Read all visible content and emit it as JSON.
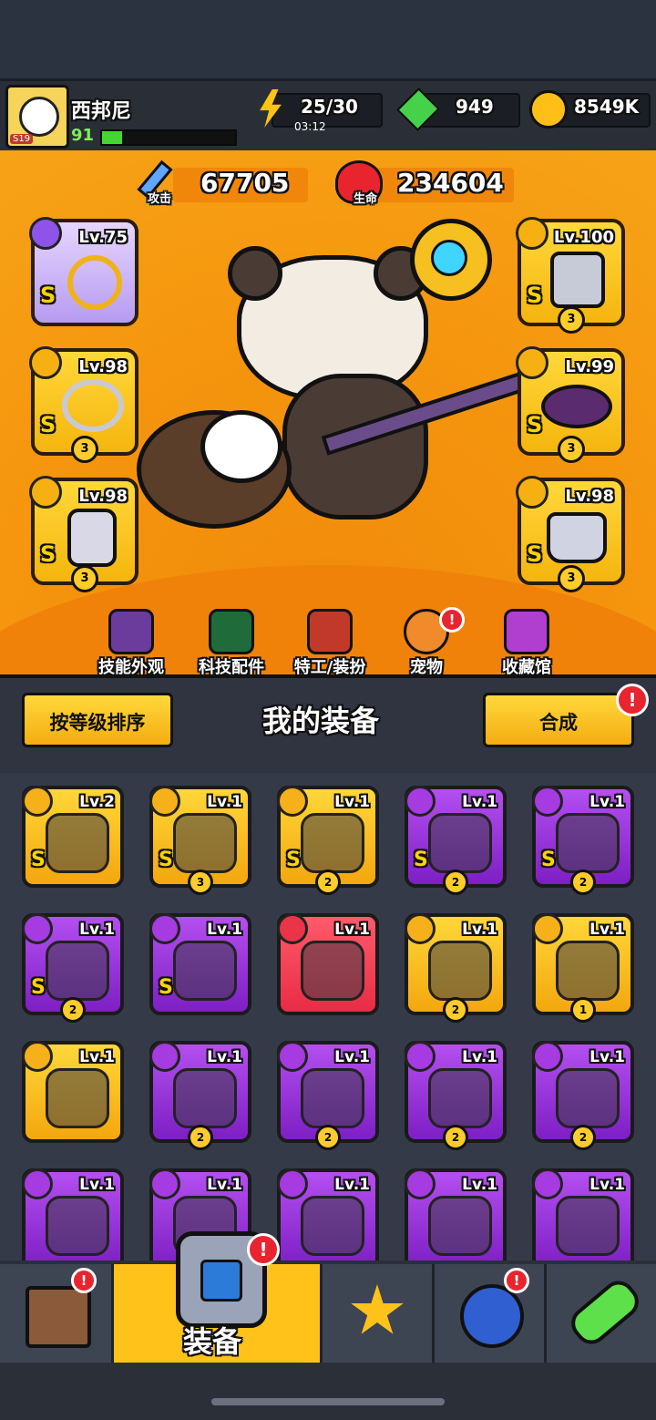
{
  "player": {
    "name": "西邦尼",
    "level": "91",
    "avatar_badge": "S19",
    "xp_progress": 0.15
  },
  "resources": {
    "energy": {
      "value": "25/30",
      "timer": "03:12",
      "icon": "lightning-icon"
    },
    "gems": {
      "value": "949",
      "icon": "green-gem-icon"
    },
    "coins": {
      "value": "8549K",
      "icon": "coin-icon"
    }
  },
  "stats": {
    "attack": {
      "label": "攻击",
      "value": "67705",
      "icon": "sword-icon"
    },
    "health": {
      "label": "生命",
      "value": "234604",
      "icon": "heart-icon"
    }
  },
  "equipped": {
    "left": [
      {
        "level": "Lv.75",
        "grade": "S",
        "count": "",
        "slot_icon": "weapon-slot-icon"
      },
      {
        "level": "Lv.98",
        "grade": "S",
        "count": "3",
        "slot_icon": "necklace-slot-icon"
      },
      {
        "level": "Lv.98",
        "grade": "S",
        "count": "3",
        "slot_icon": "glove-slot-icon"
      }
    ],
    "right": [
      {
        "level": "Lv.100",
        "grade": "S",
        "count": "3",
        "slot_icon": "armor-slot-icon"
      },
      {
        "level": "Lv.99",
        "grade": "S",
        "count": "3",
        "slot_icon": "belt-slot-icon"
      },
      {
        "level": "Lv.98",
        "grade": "S",
        "count": "3",
        "slot_icon": "boot-slot-icon"
      }
    ]
  },
  "sub_tabs": [
    {
      "label": "技能外观"
    },
    {
      "label": "科技配件"
    },
    {
      "label": "特工/装扮"
    },
    {
      "label": "宠物"
    },
    {
      "label": "收藏馆"
    }
  ],
  "equipment_header": {
    "sort_button": "按等级排序",
    "title": "我的装备",
    "merge_button": "合成",
    "alert": "!"
  },
  "inventory": [
    {
      "level": "Lv.2",
      "grade": "S",
      "count": "",
      "color": "gold"
    },
    {
      "level": "Lv.1",
      "grade": "S",
      "count": "3",
      "color": "gold"
    },
    {
      "level": "Lv.1",
      "grade": "S",
      "count": "2",
      "color": "gold"
    },
    {
      "level": "Lv.1",
      "grade": "S",
      "count": "2",
      "color": "purple"
    },
    {
      "level": "Lv.1",
      "grade": "S",
      "count": "2",
      "color": "purple"
    },
    {
      "level": "Lv.1",
      "grade": "S",
      "count": "2",
      "color": "purple"
    },
    {
      "level": "Lv.1",
      "grade": "S",
      "count": "",
      "color": "purple"
    },
    {
      "level": "Lv.1",
      "grade": "",
      "count": "",
      "color": "red"
    },
    {
      "level": "Lv.1",
      "grade": "",
      "count": "2",
      "color": "gold"
    },
    {
      "level": "Lv.1",
      "grade": "",
      "count": "1",
      "color": "gold"
    },
    {
      "level": "Lv.1",
      "grade": "",
      "count": "",
      "color": "gold"
    },
    {
      "level": "Lv.1",
      "grade": "",
      "count": "2",
      "color": "purple"
    },
    {
      "level": "Lv.1",
      "grade": "",
      "count": "2",
      "color": "purple"
    },
    {
      "level": "Lv.1",
      "grade": "",
      "count": "2",
      "color": "purple"
    },
    {
      "level": "Lv.1",
      "grade": "",
      "count": "2",
      "color": "purple"
    },
    {
      "level": "Lv.1",
      "grade": "",
      "count": "",
      "color": "purple"
    },
    {
      "level": "Lv.1",
      "grade": "",
      "count": "",
      "color": "purple"
    },
    {
      "level": "Lv.1",
      "grade": "",
      "count": "",
      "color": "purple"
    },
    {
      "level": "Lv.1",
      "grade": "",
      "count": "",
      "color": "purple"
    },
    {
      "level": "Lv.1",
      "grade": "",
      "count": "",
      "color": "purple"
    }
  ],
  "bottom_nav": [
    {
      "name": "shop",
      "label": "",
      "icon": "shop-icon",
      "alert": "!"
    },
    {
      "name": "equipment",
      "label": "装备",
      "icon": "equipment-icon",
      "alert": "!"
    },
    {
      "name": "stars",
      "label": "",
      "icon": "star-swords-icon",
      "alert": ""
    },
    {
      "name": "talent",
      "label": "",
      "icon": "planet-icon",
      "alert": "!"
    },
    {
      "name": "evolve",
      "label": "",
      "icon": "dna-capsule-icon",
      "alert": ""
    }
  ],
  "colors": {
    "gold": "#f7b012",
    "purple": "#9b34e0",
    "red": "#e82c45",
    "orange": "#f5960e"
  }
}
